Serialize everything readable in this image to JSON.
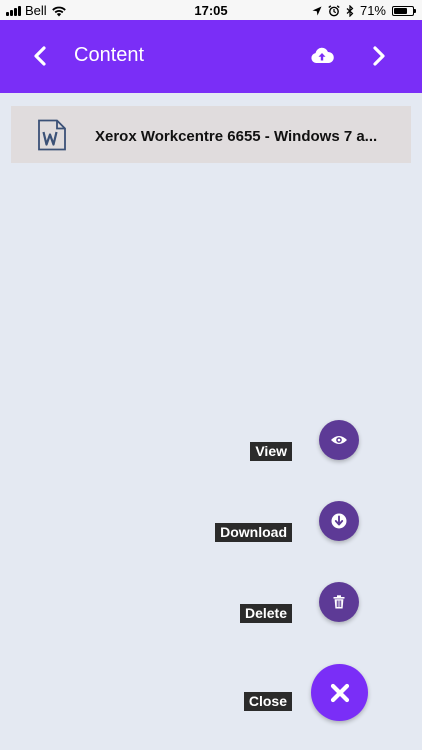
{
  "status_bar": {
    "carrier": "Bell",
    "time": "17:05",
    "battery": "71%",
    "battery_level": 0.71
  },
  "header": {
    "title": "Content",
    "back_icon": "chevron-left-icon",
    "upload_icon": "cloud-upload-icon",
    "forward_icon": "chevron-right-icon",
    "color": "#7a2ef7"
  },
  "file": {
    "name": "Xerox Workcentre 6655 - Windows 7 a...",
    "icon": "word-document-icon"
  },
  "actions": {
    "view_label": "View",
    "download_label": "Download",
    "delete_label": "Delete",
    "close_label": "Close"
  },
  "colors": {
    "fab": "#5d3a96",
    "fab_close": "#7a2ef7",
    "background": "#e4e9f2"
  }
}
